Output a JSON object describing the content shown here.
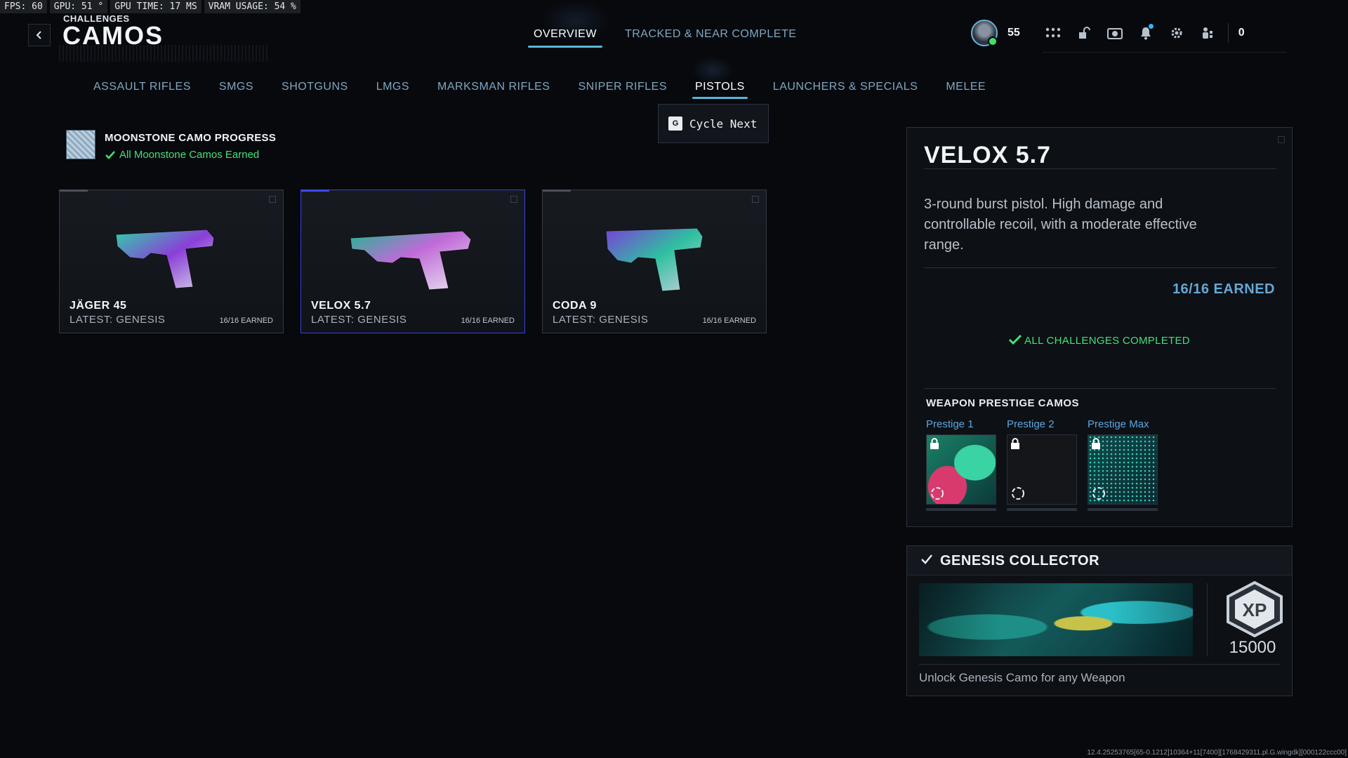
{
  "perf": {
    "fps": "FPS:  60",
    "gpu": "GPU: 51 °",
    "gpu_time": "GPU TIME: 17 MS",
    "vram": "VRAM USAGE: 54 %"
  },
  "header": {
    "breadcrumb": "CHALLENGES",
    "title": "CAMOS",
    "tabs": [
      {
        "label": "OVERVIEW",
        "active": true
      },
      {
        "label": "TRACKED & NEAR COMPLETE",
        "active": false
      }
    ]
  },
  "player": {
    "level": "55",
    "currency": "0",
    "online_color": "#3fe06c"
  },
  "icons": [
    "back-icon",
    "apps-grid-icon",
    "unlock-icon",
    "camera-icon",
    "bell-icon",
    "gear-icon",
    "party-icon"
  ],
  "categories": [
    {
      "label": "ASSAULT RIFLES",
      "active": false
    },
    {
      "label": "SMGS",
      "active": false
    },
    {
      "label": "SHOTGUNS",
      "active": false
    },
    {
      "label": "LMGS",
      "active": false
    },
    {
      "label": "MARKSMAN RIFLES",
      "active": false
    },
    {
      "label": "SNIPER RIFLES",
      "active": false
    },
    {
      "label": "PISTOLS",
      "active": true
    },
    {
      "label": "LAUNCHERS & SPECIALS",
      "active": false
    },
    {
      "label": "MELEE",
      "active": false
    }
  ],
  "cycle": {
    "key": "G",
    "label": "Cycle Next"
  },
  "progress": {
    "title": "MOONSTONE CAMO PROGRESS",
    "status": "All Moonstone Camos Earned"
  },
  "weapons": [
    {
      "name": "JÄGER 45",
      "latest": "LATEST: GENESIS",
      "earned": "16/16 EARNED",
      "selected": false
    },
    {
      "name": "VELOX 5.7",
      "latest": "LATEST: GENESIS",
      "earned": "16/16 EARNED",
      "selected": true
    },
    {
      "name": "CODA 9",
      "latest": "LATEST: GENESIS",
      "earned": "16/16 EARNED",
      "selected": false
    }
  ],
  "detail": {
    "title": "VELOX 5.7",
    "description": "3-round burst pistol. High damage and controllable recoil, with a moderate effective range.",
    "earned": "16/16 EARNED",
    "complete": "ALL CHALLENGES COMPLETED",
    "prestige_title": "WEAPON PRESTIGE CAMOS",
    "prestige": [
      {
        "label": "Prestige 1",
        "locked": true
      },
      {
        "label": "Prestige 2",
        "locked": true
      },
      {
        "label": "Prestige Max",
        "locked": true
      }
    ]
  },
  "collector": {
    "title": "GENESIS COLLECTOR",
    "xp_icon_text": "XP",
    "xp_amount": "15000",
    "description": "Unlock Genesis Camo for any Weapon"
  },
  "build_string": "12.4.25253765[65-0.1212]10364+11[7400][1768429311.pl.G.wingdk][000122ccc00]",
  "colors": {
    "accent": "#59b6d6",
    "success": "#44e07a",
    "selected_border": "#3a3fe0",
    "earned_blue": "#65a8d6"
  }
}
